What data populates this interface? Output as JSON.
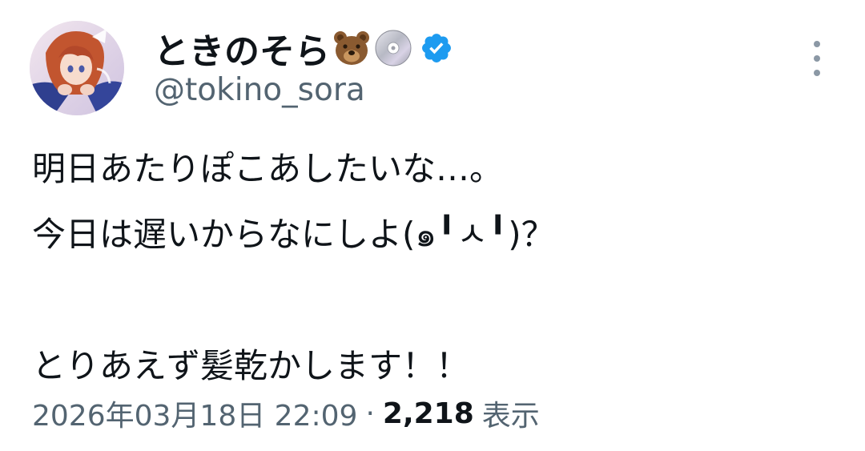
{
  "tweet": {
    "author": {
      "display_name": "ときのそら",
      "emojis": [
        "bear-face-emoji",
        "optical-disc-emoji"
      ],
      "verified": true,
      "handle": "@tokino_sora"
    },
    "text_lines": [
      "明日あたりぽこあしたいな…。",
      "今日は遅いからなにしよ(๑╹ㅅ╹)？",
      "",
      "とりあえず髪乾かします！！"
    ],
    "timestamp": "2026年03月18日 22:09",
    "separator": "·",
    "views_count": "2,218",
    "views_label": "表示"
  },
  "colors": {
    "text_primary": "#0f1419",
    "text_secondary": "#536471",
    "verified_blue": "#1d9bf0",
    "background": "#ffffff"
  },
  "icons": {
    "more": "more-vertical-icon",
    "verified": "verified-badge-icon",
    "avatar": "avatar-image"
  }
}
